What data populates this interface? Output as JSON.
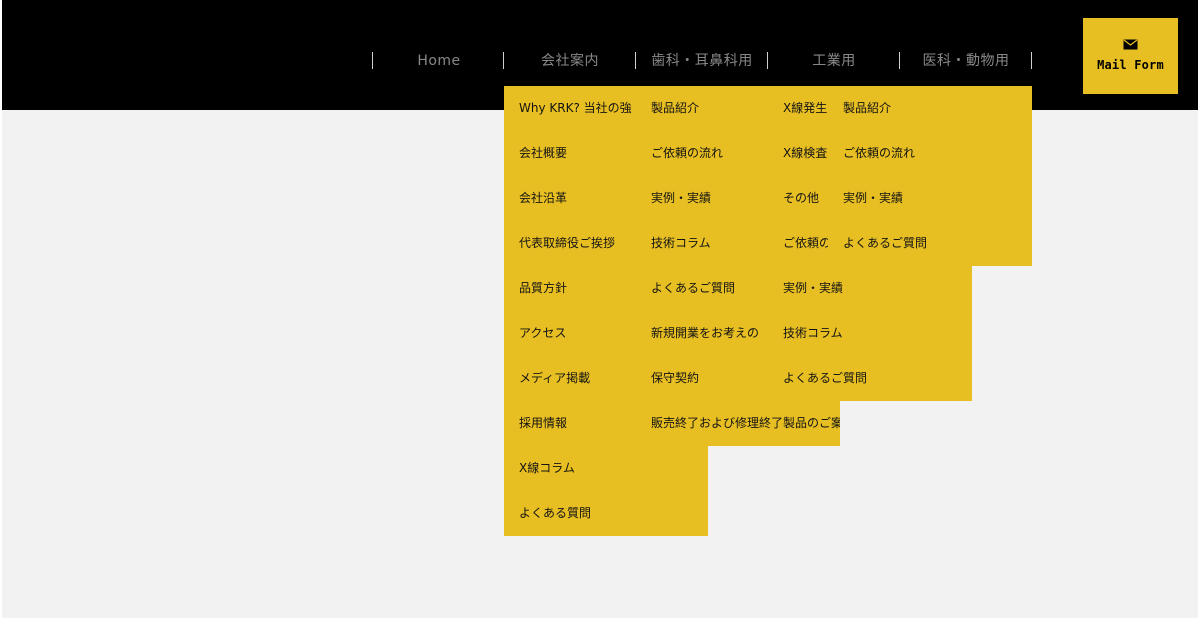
{
  "header": {
    "nav": [
      {
        "label": "Home"
      },
      {
        "label": "会社案内"
      },
      {
        "label": "歯科・耳鼻科用"
      },
      {
        "label": "工業用"
      },
      {
        "label": "医科・動物用"
      }
    ],
    "mail_button": {
      "label": "Mail Form",
      "icon": "mail-icon"
    }
  },
  "dropdowns": {
    "company": [
      "Why KRK? 当社の強",
      "会社概要",
      "会社沿革",
      "代表取締役ご挨拶",
      "品質方針",
      "アクセス",
      "メディア掲載",
      "採用情報",
      "X線コラム",
      "よくある質問"
    ],
    "dental": [
      "製品紹介",
      "ご依頼の流れ",
      "実例・実績",
      "技術コラム",
      "よくあるご質問",
      "新規開業をお考えの",
      "保守契約",
      "販売終了および修理終了製品のご案内"
    ],
    "industrial": [
      "X線発生",
      "X線検査",
      "その他",
      "ご依頼の",
      "実例・実績",
      "技術コラム",
      "よくあるご質問"
    ],
    "medical": [
      "製品紹介",
      "ご依頼の流れ",
      "実例・実績",
      "よくあるご質問"
    ]
  },
  "colors": {
    "accent": "#e8bf22",
    "header_bg": "#000000",
    "page_bg": "#f2f2f2"
  }
}
